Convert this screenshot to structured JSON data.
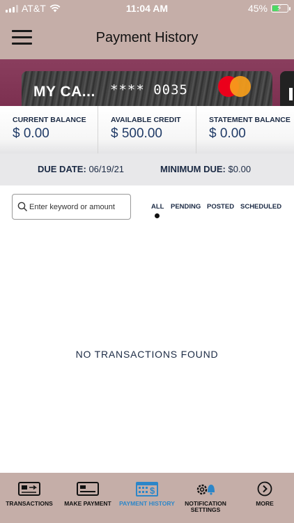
{
  "status_bar": {
    "carrier": "AT&T",
    "time": "11:04 AM",
    "battery": "45%",
    "battery_level": 0.45
  },
  "header": {
    "title": "Payment History"
  },
  "card": {
    "name": "MY CA...",
    "number": "**** 0035",
    "brand_icon": "mastercard-logo"
  },
  "balances": [
    {
      "label": "CURRENT BALANCE",
      "value": "$ 0.00"
    },
    {
      "label": "AVAILABLE CREDIT",
      "value": "$ 500.00"
    },
    {
      "label": "STATEMENT BALANCE",
      "value": "$ 0.00"
    }
  ],
  "due": {
    "due_label": "DUE DATE:",
    "due_value": "06/19/21",
    "min_label": "MINIMUM DUE:",
    "min_value": "$0.00"
  },
  "search": {
    "placeholder": "Enter keyword or amount",
    "icon": "search-icon"
  },
  "filters": {
    "items": [
      "ALL",
      "PENDING",
      "POSTED",
      "SCHEDULED"
    ],
    "selected": "ALL"
  },
  "empty_message": "NO TRANSACTIONS FOUND",
  "tabs": [
    {
      "label": "TRANSACTIONS",
      "icon": "transactions-icon"
    },
    {
      "label": "MAKE PAYMENT",
      "icon": "card-icon"
    },
    {
      "label": "PAYMENT HISTORY",
      "icon": "calendar-dollar-icon",
      "active": true
    },
    {
      "label": "NOTIFICATION SETTINGS",
      "icon": "gear-bell-icon"
    },
    {
      "label": "MORE",
      "icon": "chevron-right-circle-icon"
    }
  ],
  "colors": {
    "header_bg": "#c5aea8",
    "card_band": "#8a3e5e",
    "active_tab": "#2c86c8",
    "text_navy": "#1b2a44"
  }
}
